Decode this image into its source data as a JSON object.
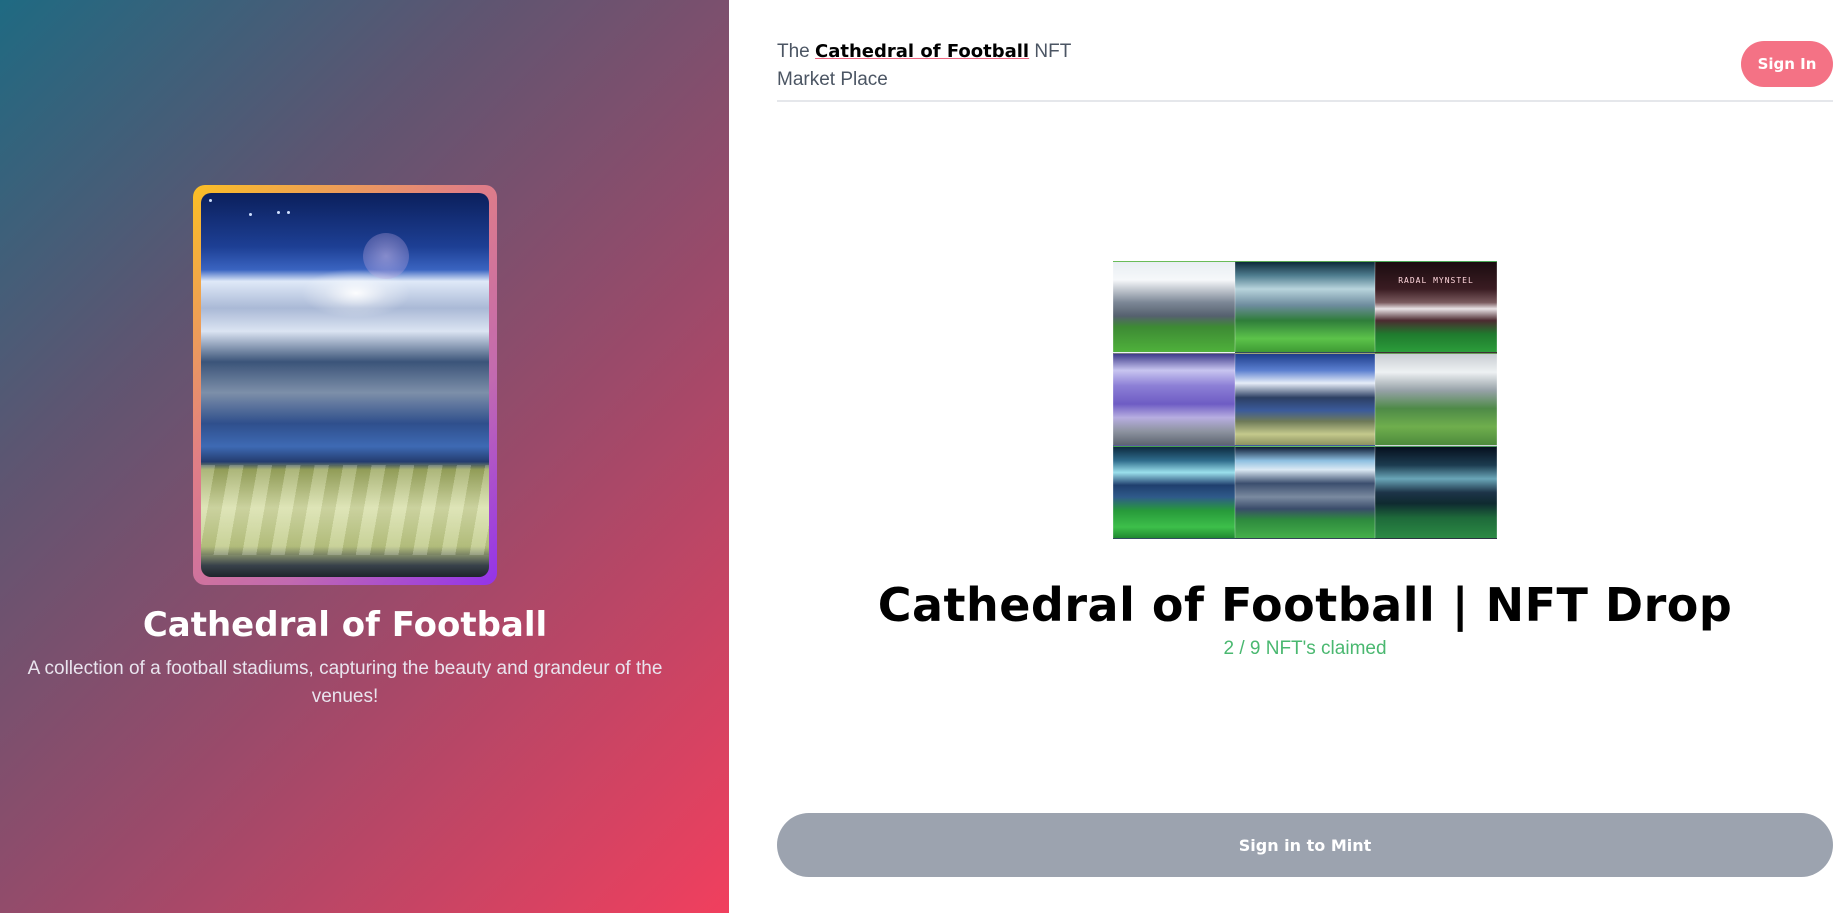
{
  "left_panel": {
    "collection_title": "Cathedral of Football",
    "collection_description": "A collection of a football stadiums, capturing the beauty and grandeur of the venues!"
  },
  "header": {
    "brand_prefix": "The ",
    "brand_highlight": "Cathedral of Football",
    "brand_suffix": " NFT",
    "brand_line2": "Market Place",
    "sign_in_label": "Sign In"
  },
  "main": {
    "collage_sign_text": "RADAL MYNSTEL",
    "drop_title": "Cathedral of Football | NFT Drop",
    "claimed_text": "2 / 9 NFT's claimed",
    "mint_button_label": "Sign in to Mint"
  },
  "colors": {
    "sign_in_button": "#f47285",
    "claimed_text": "#4ab870",
    "mint_button": "#9ca3af"
  }
}
